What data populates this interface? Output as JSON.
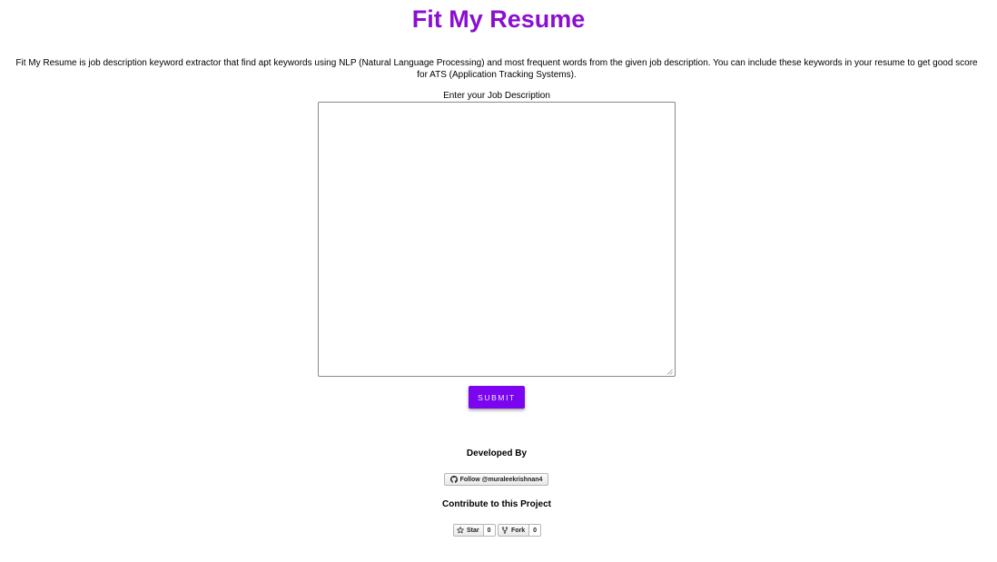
{
  "header": {
    "title": "Fit My Resume",
    "description": "Fit My Resume is job description keyword extractor that find apt keywords using NLP (Natural Language Processing) and most frequent words from the given job description. You can include these keywords in your resume to get good score for ATS (Application Tracking Systems)."
  },
  "form": {
    "label": "Enter your Job Description",
    "textarea_value": "",
    "submit_label": "SUBMIT"
  },
  "footer": {
    "developed_by": "Developed By",
    "follow_label": "Follow @muraleekrishnan4",
    "contribute": "Contribute to this Project",
    "star_label": "Star",
    "star_count": "0",
    "fork_label": "Fork",
    "fork_count": "0"
  },
  "colors": {
    "accent": "#8a0fd0",
    "button": "#7a05ee"
  },
  "icons": [
    "github-icon",
    "star-icon",
    "fork-icon"
  ]
}
